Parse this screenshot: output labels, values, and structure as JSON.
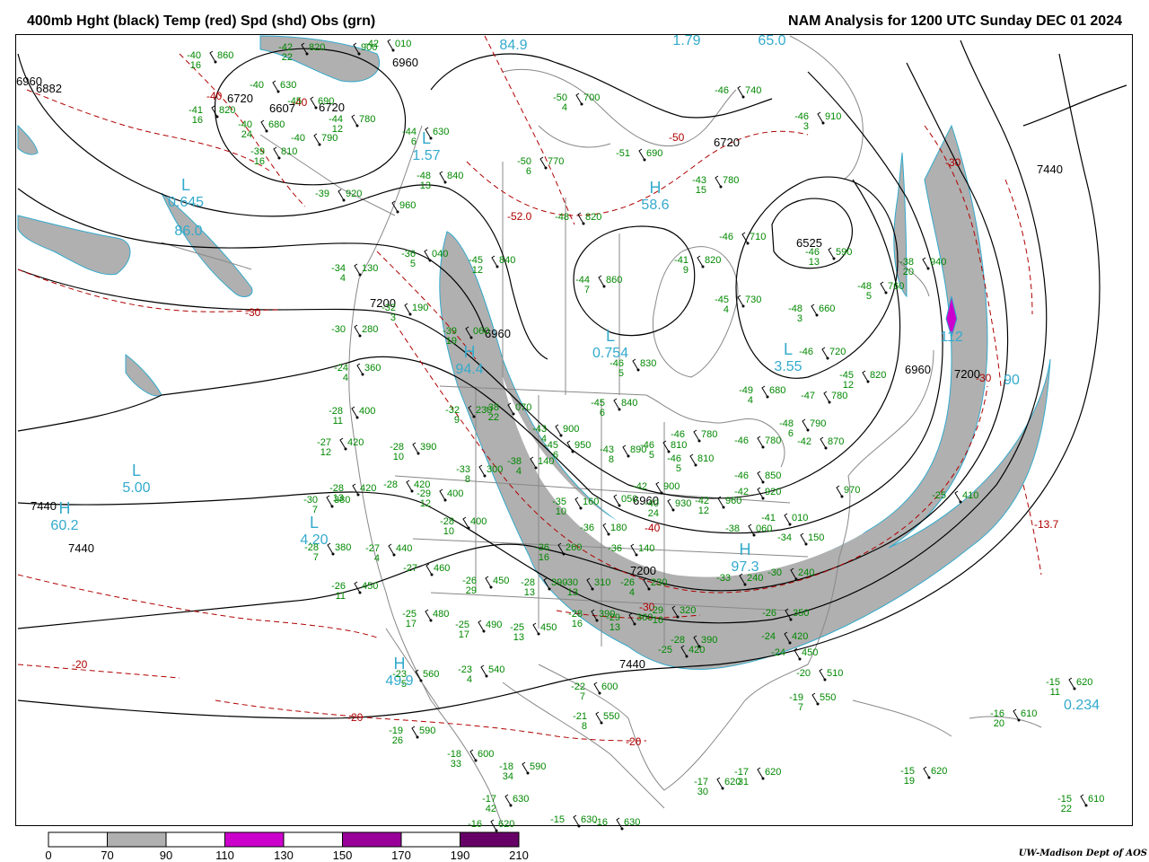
{
  "header": {
    "title_left": "400mb Hght (black) Temp (red) Spd (shd) Obs (grn)",
    "title_right": "NAM Analysis for 1200 UTC Sunday  DEC 01 2024"
  },
  "credit": "UW-Madison  Dept of AOS",
  "colors": {
    "height": "#000000",
    "temp": "#b00000",
    "obs": "#008800",
    "label": "#33aacc",
    "shade70": "#b0b0b0",
    "shade110": "#cc00cc",
    "shade150": "#990099",
    "shade190": "#660066",
    "geo": "#888888"
  },
  "colorbar": {
    "ticks": [
      "0",
      "70",
      "90",
      "110",
      "130",
      "150",
      "170",
      "190",
      "210"
    ],
    "segments": [
      {
        "from": "0",
        "to": "70",
        "color": "#ffffff"
      },
      {
        "from": "70",
        "to": "90",
        "color": "#b0b0b0"
      },
      {
        "from": "90",
        "to": "110",
        "color": "#ffffff"
      },
      {
        "from": "110",
        "to": "130",
        "color": "#cc00cc"
      },
      {
        "from": "130",
        "to": "150",
        "color": "#ffffff"
      },
      {
        "from": "150",
        "to": "170",
        "color": "#990099"
      },
      {
        "from": "170",
        "to": "190",
        "color": "#ffffff"
      },
      {
        "from": "190",
        "to": "210",
        "color": "#660066"
      }
    ]
  },
  "height_labels": [
    "6960",
    "6882",
    "6720",
    "6607",
    "6720",
    "6960",
    "6720",
    "6525",
    "7200",
    "6960",
    "6960",
    "7440",
    "7440",
    "7200",
    "7440",
    "6960",
    "7200",
    "7440"
  ],
  "temp_labels": [
    "-40",
    "-40",
    "-50",
    "-30",
    "-52.0",
    "-40",
    "-30",
    "-20",
    "-20",
    "-20",
    "-30",
    "-13.7",
    "-30"
  ],
  "centers": [
    {
      "symbol": "L",
      "value": "0.645"
    },
    {
      "symbol": "",
      "value": "86.0"
    },
    {
      "symbol": "L",
      "value": "1.57"
    },
    {
      "symbol": "",
      "value": "84.9"
    },
    {
      "symbol": "",
      "value": "1.79"
    },
    {
      "symbol": "",
      "value": "65.0"
    },
    {
      "symbol": "H",
      "value": "58.6"
    },
    {
      "symbol": "L",
      "value": "0.754"
    },
    {
      "symbol": "H",
      "value": "94.4"
    },
    {
      "symbol": "L",
      "value": "3.55"
    },
    {
      "symbol": "L",
      "value": "5.00"
    },
    {
      "symbol": "H",
      "value": "60.2"
    },
    {
      "symbol": "L",
      "value": "4.20"
    },
    {
      "symbol": "H",
      "value": "49.9"
    },
    {
      "symbol": "H",
      "value": "97.3"
    },
    {
      "symbol": "",
      "value": "0.234"
    },
    {
      "symbol": "",
      "value": "112"
    },
    {
      "symbol": "",
      "value": "90"
    }
  ],
  "observations": [
    {
      "t": "-40",
      "d": "16",
      "h": "860"
    },
    {
      "t": "-42",
      "d": "22",
      "h": "820"
    },
    {
      "t": "",
      "d": "",
      "h": "900"
    },
    {
      "t": "-42",
      "d": "",
      "h": "010"
    },
    {
      "t": "-40",
      "d": "",
      "h": "630"
    },
    {
      "t": "-41",
      "d": "16",
      "h": "820"
    },
    {
      "t": "-45",
      "d": "",
      "h": "690"
    },
    {
      "t": "-40",
      "d": "24",
      "h": "680"
    },
    {
      "t": "-44",
      "d": "12",
      "h": "780"
    },
    {
      "t": "-40",
      "d": "",
      "h": "790"
    },
    {
      "t": "-39",
      "d": "16",
      "h": "810"
    },
    {
      "t": "-44",
      "d": "6",
      "h": "630"
    },
    {
      "t": "-50",
      "d": "4",
      "h": "700"
    },
    {
      "t": "-46",
      "d": "",
      "h": "740"
    },
    {
      "t": "-46",
      "d": "3",
      "h": "910"
    },
    {
      "t": "-50",
      "d": "6",
      "h": "770"
    },
    {
      "t": "-51",
      "d": "",
      "h": "690"
    },
    {
      "t": "-48",
      "d": "13",
      "h": "840"
    },
    {
      "t": "-43",
      "d": "15",
      "h": "780"
    },
    {
      "t": "-39",
      "d": "",
      "h": "920"
    },
    {
      "t": "",
      "d": "",
      "h": "960"
    },
    {
      "t": "-48",
      "d": "",
      "h": "820"
    },
    {
      "t": "-46",
      "d": "",
      "h": "710"
    },
    {
      "t": "-46",
      "d": "13",
      "h": "590"
    },
    {
      "t": "-36",
      "d": "5",
      "h": "040"
    },
    {
      "t": "-45",
      "d": "12",
      "h": "840"
    },
    {
      "t": "-41",
      "d": "9",
      "h": "820"
    },
    {
      "t": "-34",
      "d": "4",
      "h": "130"
    },
    {
      "t": "-44",
      "d": "7",
      "h": "860"
    },
    {
      "t": "-45",
      "d": "4",
      "h": "730"
    },
    {
      "t": "-38",
      "d": "20",
      "h": "940"
    },
    {
      "t": "-32",
      "d": "3",
      "h": "190"
    },
    {
      "t": "-48",
      "d": "5",
      "h": "760"
    },
    {
      "t": "-48",
      "d": "3",
      "h": "660"
    },
    {
      "t": "-30",
      "d": "",
      "h": "280"
    },
    {
      "t": "-39",
      "d": "19",
      "h": "060"
    },
    {
      "t": "-46",
      "d": "5",
      "h": "830"
    },
    {
      "t": "-46",
      "d": "",
      "h": "720"
    },
    {
      "t": "-24",
      "d": "4",
      "h": "360"
    },
    {
      "t": "-45",
      "d": "12",
      "h": "820"
    },
    {
      "t": "-49",
      "d": "4",
      "h": "680"
    },
    {
      "t": "-28",
      "d": "11",
      "h": "400"
    },
    {
      "t": "-32",
      "d": "9",
      "h": "230"
    },
    {
      "t": "-38",
      "d": "22",
      "h": "070"
    },
    {
      "t": "-45",
      "d": "6",
      "h": "840"
    },
    {
      "t": "-47",
      "d": "",
      "h": "780"
    },
    {
      "t": "-43",
      "d": "4",
      "h": "900"
    },
    {
      "t": "-48",
      "d": "6",
      "h": "790"
    },
    {
      "t": "-27",
      "d": "12",
      "h": "420"
    },
    {
      "t": "-28",
      "d": "10",
      "h": "390"
    },
    {
      "t": "-45",
      "d": "6",
      "h": "950"
    },
    {
      "t": "-43",
      "d": "8",
      "h": "890"
    },
    {
      "t": "-46",
      "d": "5",
      "h": "810"
    },
    {
      "t": "-46",
      "d": "",
      "h": "780"
    },
    {
      "t": "-46",
      "d": "",
      "h": "780"
    },
    {
      "t": "-42",
      "d": "",
      "h": "870"
    },
    {
      "t": "-33",
      "d": "8",
      "h": "300"
    },
    {
      "t": "-38",
      "d": "4",
      "h": "140"
    },
    {
      "t": "-46",
      "d": "5",
      "h": "810"
    },
    {
      "t": "-46",
      "d": "",
      "h": "850"
    },
    {
      "t": "-28",
      "d": "13",
      "h": "420"
    },
    {
      "t": "-28",
      "d": "",
      "h": "420"
    },
    {
      "t": "-29",
      "d": "12",
      "h": "400"
    },
    {
      "t": "-42",
      "d": "",
      "h": "900"
    },
    {
      "t": "-42",
      "d": "",
      "h": "920"
    },
    {
      "t": "",
      "d": "",
      "h": "970"
    },
    {
      "t": "-30",
      "d": "7",
      "h": "380"
    },
    {
      "t": "-35",
      "d": "10",
      "h": "160"
    },
    {
      "t": "",
      "d": "",
      "h": "050"
    },
    {
      "t": "-40",
      "d": "24",
      "h": "930"
    },
    {
      "t": "-42",
      "d": "12",
      "h": "960"
    },
    {
      "t": "-41",
      "d": "",
      "h": "010"
    },
    {
      "t": "-25",
      "d": "",
      "h": "410"
    },
    {
      "t": "-28",
      "d": "10",
      "h": "400"
    },
    {
      "t": "-36",
      "d": "",
      "h": "180"
    },
    {
      "t": "-38",
      "d": "",
      "h": "060"
    },
    {
      "t": "-34",
      "d": "",
      "h": "150"
    },
    {
      "t": "-28",
      "d": "7",
      "h": "380"
    },
    {
      "t": "-27",
      "d": "4",
      "h": "440"
    },
    {
      "t": "-36",
      "d": "16",
      "h": "260"
    },
    {
      "t": "-36",
      "d": "",
      "h": "140"
    },
    {
      "t": "-27",
      "d": "",
      "h": "460"
    },
    {
      "t": "-26",
      "d": "29",
      "h": "450"
    },
    {
      "t": "-28",
      "d": "13",
      "h": "390"
    },
    {
      "t": "-30",
      "d": "13",
      "h": "310"
    },
    {
      "t": "-26",
      "d": "4",
      "h": "230"
    },
    {
      "t": "-33",
      "d": "",
      "h": "240"
    },
    {
      "t": "-30",
      "d": "",
      "h": "240"
    },
    {
      "t": "-26",
      "d": "11",
      "h": "450"
    },
    {
      "t": "-25",
      "d": "17",
      "h": "480"
    },
    {
      "t": "-28",
      "d": "16",
      "h": "390"
    },
    {
      "t": "-29",
      "d": "13",
      "h": "360"
    },
    {
      "t": "-29",
      "d": "16",
      "h": "320"
    },
    {
      "t": "-26",
      "d": "",
      "h": "350"
    },
    {
      "t": "-25",
      "d": "17",
      "h": "490"
    },
    {
      "t": "-25",
      "d": "13",
      "h": "450"
    },
    {
      "t": "-25",
      "d": "",
      "h": "420"
    },
    {
      "t": "-24",
      "d": "",
      "h": "420"
    },
    {
      "t": "-28",
      "d": "",
      "h": "390"
    },
    {
      "t": "-24",
      "d": "",
      "h": "450"
    },
    {
      "t": "-23",
      "d": "5",
      "h": "560"
    },
    {
      "t": "-23",
      "d": "4",
      "h": "540"
    },
    {
      "t": "-20",
      "d": "",
      "h": "510"
    },
    {
      "t": "-22",
      "d": "7",
      "h": "600"
    },
    {
      "t": "-19",
      "d": "7",
      "h": "550"
    },
    {
      "t": "-15",
      "d": "11",
      "h": "620"
    },
    {
      "t": "-21",
      "d": "8",
      "h": "550"
    },
    {
      "t": "-16",
      "d": "20",
      "h": "610"
    },
    {
      "t": "-19",
      "d": "26",
      "h": "590"
    },
    {
      "t": "-18",
      "d": "33",
      "h": "600"
    },
    {
      "t": "-18",
      "d": "34",
      "h": "590"
    },
    {
      "t": "-17",
      "d": "30",
      "h": "620"
    },
    {
      "t": "-17",
      "d": "31",
      "h": "620"
    },
    {
      "t": "-15",
      "d": "19",
      "h": "620"
    },
    {
      "t": "-17",
      "d": "42",
      "h": "630"
    },
    {
      "t": "-16",
      "d": "",
      "h": "620"
    },
    {
      "t": "-15",
      "d": "",
      "h": "630"
    },
    {
      "t": "-16",
      "d": "",
      "h": "630"
    },
    {
      "t": "-15",
      "d": "22",
      "h": "610"
    }
  ]
}
